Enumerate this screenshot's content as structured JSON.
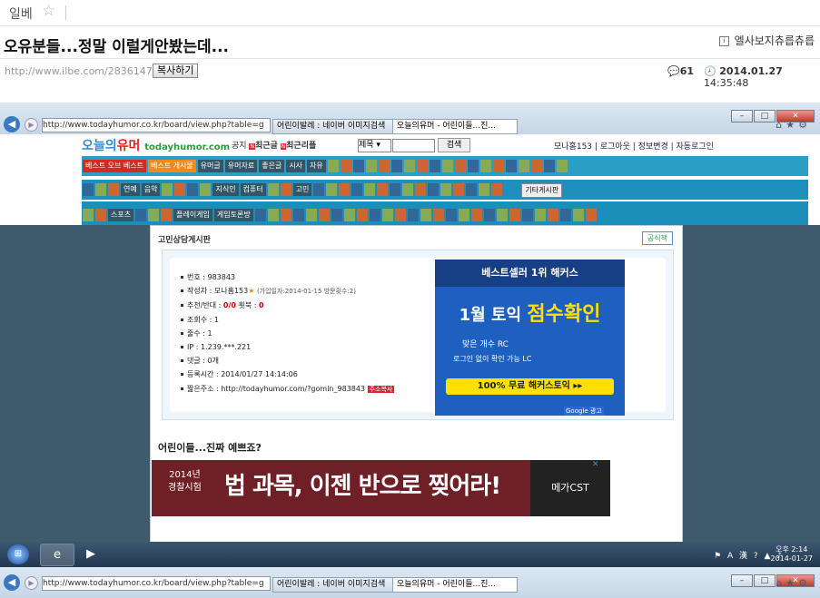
{
  "header": {
    "board_name": "일베",
    "post_title": "오유분들...정말 이럴게안봤는데...",
    "related_label": "엘사보지츄릅츄릅",
    "post_url": "http://www.ilbe.com/2836147999",
    "copy_button": "복사하기",
    "comment_count": "61",
    "date": "2014.01.27",
    "time": "14:35:48"
  },
  "screenshot": {
    "address": "http://www.todayhumor.co.kr/board/view.php?table=g",
    "tabs": [
      {
        "label": "어린이발레 : 네이버 이미지검색",
        "active": false
      },
      {
        "label": "오늘의유머 - 어린이들...진...",
        "active": true
      }
    ],
    "site": {
      "logo_ko": "오늘의",
      "logo_red": "유머",
      "logo_en": "todayhumor.com",
      "notice_label": "공지",
      "recent_label": "최근글",
      "recent_reply_label": "최근리플",
      "select_value": "제목",
      "search_button": "검색",
      "user_links": "모나홈153  |  로그아웃  |  정보변경  |  자동로그인"
    },
    "nav": {
      "row1": [
        "베스트 오브 베스트",
        "베스트 게시물",
        "유머글",
        "유머자료",
        "좋은글",
        "시사",
        "자유"
      ],
      "row2": [
        "연예",
        "음악",
        "지식인",
        "컴퓨터",
        "고민",
        "기타게시판"
      ],
      "row3": [
        "스포츠",
        "플레이게임",
        "게임토론방"
      ]
    },
    "board": {
      "title": "고민상담게시판",
      "official_label": "공식책",
      "info": [
        {
          "label": "번호 : 983843"
        },
        {
          "label": "작성자 : 모나홈153",
          "extra": "(가입일자:2014-01-15 방문횟수:2)"
        },
        {
          "label": "추천/반대 : ",
          "red": "0/0",
          "label2": "    횟북 : ",
          "red2": "0"
        },
        {
          "label": "조회수 : 1"
        },
        {
          "label": "줄수 : 1"
        },
        {
          "label": "IP : 1.239.***.221"
        },
        {
          "label": "댓글 : 0개"
        },
        {
          "label": "등록시간 : 2014/01/27 14:14:06"
        },
        {
          "label": "짧은주소 : http://todayhumor.com/?gomin_983843",
          "button": "주소복사"
        }
      ],
      "ad": {
        "top": "베스트셀러 1위 해커스",
        "big1": "1월 토익 ",
        "big2": "점수확인",
        "rc": "맞은 개수   RC",
        "lc": "로그인 없이 확인 가능   LC",
        "button": "100% 무료 해커스토익 ▸▸",
        "google": "Google 광고"
      },
      "sub_title": "어린이들...진짜 예쁘죠?",
      "ad2": {
        "line1": "2014년",
        "line2": "경찰시험",
        "big": "법 과목, 이젠 반으로 찢어라!",
        "brand": "메가CST"
      }
    },
    "taskbar": {
      "time": "오후 2:14",
      "date": "2014-01-27"
    }
  }
}
